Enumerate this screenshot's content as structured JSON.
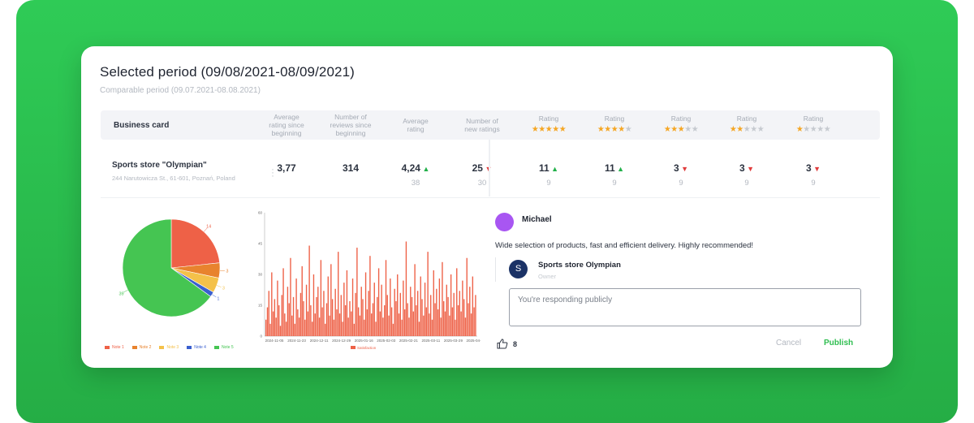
{
  "header": {
    "title": "Selected period (09/08/2021-08/09/2021)",
    "subtitle": "Comparable period (09.07.2021-08.08.2021)"
  },
  "table": {
    "business_col": "Business card",
    "columns": [
      {
        "label": "Average rating since beginning",
        "lines": [
          "Average",
          "rating since",
          "beginning"
        ]
      },
      {
        "label": "Number of reviews since beginning",
        "lines": [
          "Number of",
          "reviews since",
          "beginning"
        ]
      },
      {
        "label": "Average rating",
        "lines": [
          "Average",
          "rating"
        ]
      },
      {
        "label": "Number of new ratings",
        "lines": [
          "Number of",
          "new ratings"
        ]
      },
      {
        "label": "Rating",
        "lines": [
          "Rating"
        ],
        "stars": 5
      },
      {
        "label": "Rating",
        "lines": [
          "Rating"
        ],
        "stars": 4
      },
      {
        "label": "Rating",
        "lines": [
          "Rating"
        ],
        "stars": 3
      },
      {
        "label": "Rating",
        "lines": [
          "Rating"
        ],
        "stars": 2
      },
      {
        "label": "Rating",
        "lines": [
          "Rating"
        ],
        "stars": 1
      }
    ],
    "row": {
      "name": "Sports store \"Olympian\"",
      "address": "244 Narutowicza St., 61-601, Poznań, Poland",
      "cells": [
        {
          "value": "3,77",
          "trend": "",
          "sub": ""
        },
        {
          "value": "314",
          "trend": "",
          "sub": ""
        },
        {
          "value": "4,24",
          "trend": "up",
          "sub": "38"
        },
        {
          "value": "25",
          "trend": "down",
          "sub": "30"
        },
        {
          "value": "11",
          "trend": "up",
          "sub": "9"
        },
        {
          "value": "11",
          "trend": "up",
          "sub": "9"
        },
        {
          "value": "3",
          "trend": "down",
          "sub": "9"
        },
        {
          "value": "3",
          "trend": "down",
          "sub": "9"
        },
        {
          "value": "3",
          "trend": "down",
          "sub": "9"
        }
      ]
    }
  },
  "chart_data": [
    {
      "type": "pie",
      "labels": [
        "Note 1",
        "Note 2",
        "Note 3",
        "Note 4",
        "Note 5"
      ],
      "values": [
        14,
        3,
        3,
        1,
        39
      ],
      "colors": [
        "#ee6147",
        "#e8832e",
        "#f4c14a",
        "#3a5fcf",
        "#45c552"
      ],
      "legend": "bottom"
    },
    {
      "type": "bar",
      "ylim": [
        0,
        60
      ],
      "yticks": [
        0,
        15,
        30,
        45,
        60
      ],
      "xticks": [
        "2024-11-05",
        "2024-11-23",
        "2024-12-11",
        "2024-12-29",
        "2025-01-16",
        "2025-02-03",
        "2025-02-21",
        "2025-03-11",
        "2025-03-29",
        "2025-04-16"
      ],
      "series": [
        {
          "name": "Satisfaction",
          "color": "#ee6147"
        }
      ],
      "values": [
        8,
        14,
        22,
        6,
        31,
        12,
        18,
        9,
        27,
        15,
        5,
        20,
        33,
        11,
        7,
        24,
        16,
        38,
        10,
        19,
        6,
        28,
        13,
        9,
        21,
        34,
        17,
        8,
        25,
        12,
        44,
        15,
        7,
        30,
        11,
        19,
        24,
        9,
        37,
        14,
        22,
        6,
        16,
        29,
        10,
        35,
        18,
        8,
        23,
        13,
        41,
        11,
        20,
        7,
        26,
        15,
        32,
        9,
        17,
        12,
        28,
        6,
        21,
        43,
        14,
        10,
        24,
        18,
        8,
        31,
        13,
        22,
        39,
        11,
        16,
        26,
        7,
        19,
        33,
        12,
        25,
        9,
        15,
        37,
        20,
        10,
        28,
        14,
        6,
        23,
        17,
        30,
        11,
        21,
        8,
        27,
        13,
        46,
        16,
        9,
        24,
        19,
        12,
        35,
        15,
        22,
        7,
        29,
        18,
        10,
        26,
        14,
        41,
        11,
        20,
        8,
        32,
        16,
        23,
        13,
        28,
        9,
        36,
        17,
        12,
        25,
        19,
        10,
        30,
        14,
        21,
        8,
        33,
        15,
        22,
        12,
        27,
        18,
        9,
        38,
        16,
        24,
        11,
        29,
        14,
        20
      ],
      "legend": "bottom"
    }
  ],
  "review": {
    "reviewer": "Michael",
    "text": "Wide selection of products, fast and efficient delivery. Highly recommended!",
    "owner_initial": "S",
    "owner_name": "Sports store Olympian",
    "owner_role": "Owner",
    "reply_placeholder": "You're responding publicly",
    "likes": "8",
    "cancel": "Cancel",
    "publish": "Publish"
  }
}
